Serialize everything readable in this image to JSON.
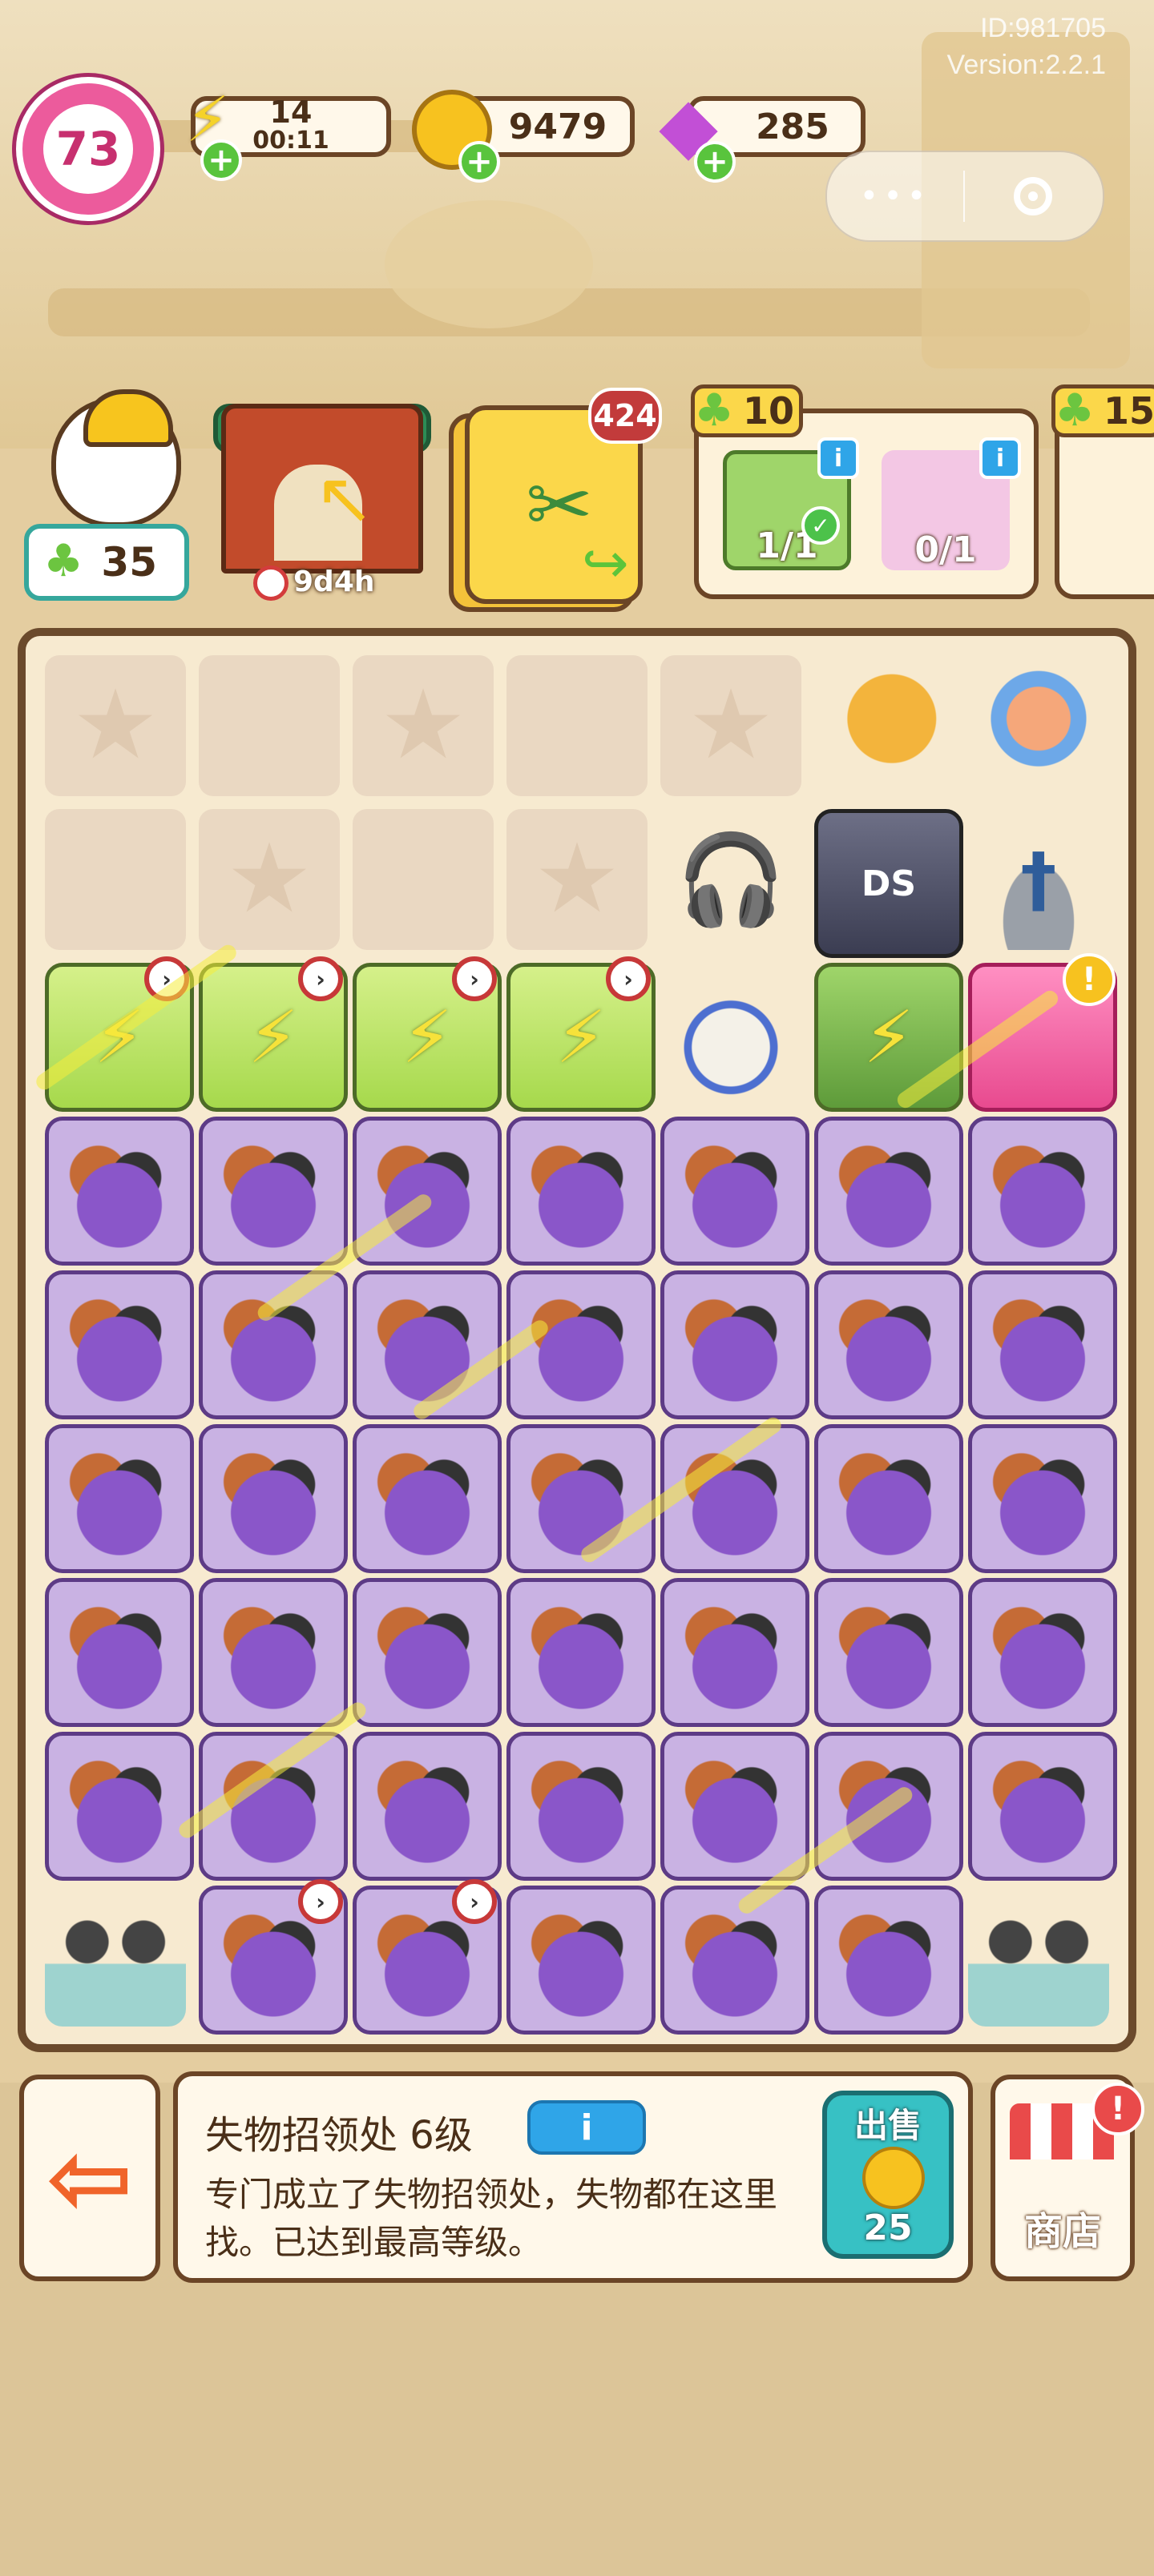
{
  "meta": {
    "id_text": "ID:981705",
    "version_text": "Version:2.2.1"
  },
  "hud": {
    "level": "73",
    "energy": {
      "value": "14",
      "timer": "00:11",
      "icon": "lightning-icon"
    },
    "coins": {
      "value": "9479",
      "icon": "coin-icon"
    },
    "gems": {
      "value": "285",
      "icon": "gem-icon"
    },
    "capsule_dots": "•••"
  },
  "player": {
    "clover_count": "35"
  },
  "event": {
    "timer": "9d4h"
  },
  "inventory": {
    "count": "424"
  },
  "orders": [
    {
      "reward": "10",
      "items": [
        {
          "progress": "1/1",
          "done": true
        },
        {
          "progress": "0/1",
          "done": false
        }
      ]
    },
    {
      "reward": "15",
      "items": []
    }
  ],
  "board": {
    "chest_rows": 5
  },
  "panel": {
    "title": "失物招领处 6级",
    "info_label": "i",
    "description": "专门成立了失物招领处，失物都在这里找。已达到最高等级。",
    "sell_label": "出售",
    "sell_price": "25",
    "shop_label": "商店"
  },
  "colors": {
    "accent": "#ec5b9c",
    "board_border": "#6b4a2c",
    "gold": "#f7c21f",
    "teal": "#37c1c4"
  }
}
